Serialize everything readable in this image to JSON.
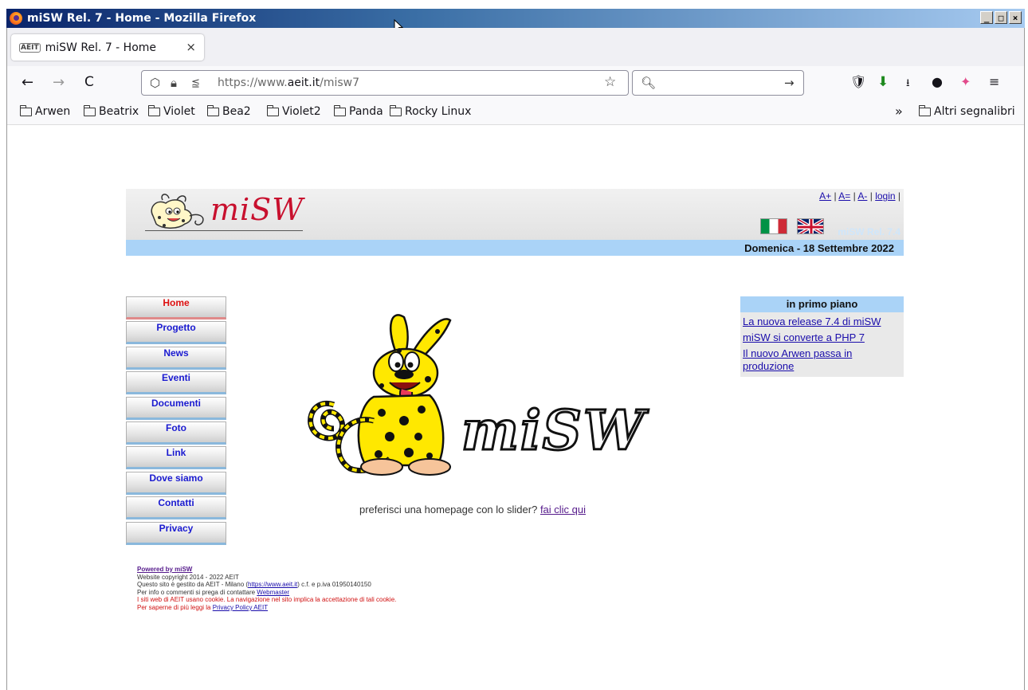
{
  "window": {
    "title": "miSW Rel. 7 - Home - Mozilla Firefox",
    "buttons": [
      "_",
      "□",
      "×"
    ]
  },
  "tab": {
    "favicon": "AEIT",
    "title": "miSW Rel. 7 - Home",
    "close": "×"
  },
  "nav": {
    "back": "←",
    "forward": "→",
    "reload": "C",
    "url_prefix": "https://www.",
    "url_domain": "aeit.it",
    "url_path": "/misw7",
    "search_placeholder": ""
  },
  "bookmarks": [
    "Arwen",
    "Beatrix",
    "Violet",
    "Bea2",
    "Violet2",
    "Panda",
    "Rocky Linux"
  ],
  "bookmarks_overflow": "»",
  "bookmarks_other": "Altri segnalibri",
  "header": {
    "logo": "miSW",
    "links": [
      "A+",
      "A=",
      "A-",
      "login"
    ],
    "release": "miSW Rel. 7.4",
    "date": "Domenica - 18 Settembre 2022"
  },
  "menu": [
    {
      "label": "Home",
      "active": true
    },
    {
      "label": "Progetto"
    },
    {
      "label": "News"
    },
    {
      "label": "Eventi"
    },
    {
      "label": "Documenti"
    },
    {
      "label": "Foto"
    },
    {
      "label": "Link"
    },
    {
      "label": "Dove siamo"
    },
    {
      "label": "Contatti"
    },
    {
      "label": "Privacy"
    }
  ],
  "main": {
    "mascot_text": "miSW",
    "slider_text": "preferisci una homepage con lo slider?",
    "slider_link": "fai clic qui"
  },
  "side": {
    "title": "in primo piano",
    "items": [
      "La nuova release 7.4 di miSW",
      "miSW si converte a PHP 7",
      "Il nuovo Arwen passa in produzione"
    ]
  },
  "footer": {
    "powered": "Powered by miSW",
    "copyright": "Website copyright 2014 - 2022 AEIT",
    "managed_pre": "Questo sito è gestito da AEIT - Milano (",
    "managed_link": "https://www.aeit.it",
    "managed_post": ") c.f. e p.iva 01950140150",
    "info_pre": "Per info o commenti si prega di contattare ",
    "info_link": "Webmaster",
    "cookie": "I siti web di AEIT usano cookie. La navigazione nel sito implica la accettazione di tali cookie.",
    "privacy_pre": "Per saperne di più leggi la ",
    "privacy_link": "Privacy Policy AEIT"
  }
}
